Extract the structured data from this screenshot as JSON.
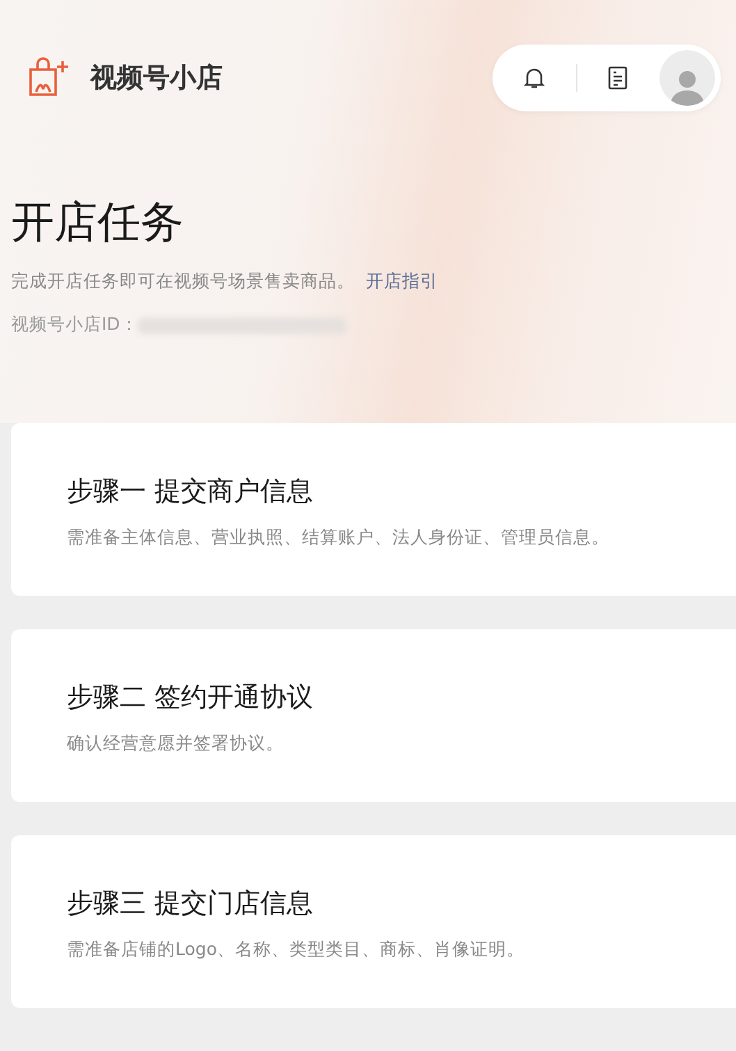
{
  "header": {
    "brand": "视频号小店"
  },
  "page": {
    "title": "开店任务",
    "description": "完成开店任务即可在视频号场景售卖商品。",
    "guide_link": "开店指引",
    "id_label": "视频号小店ID："
  },
  "steps": [
    {
      "title": "步骤一 提交商户信息",
      "description": "需准备主体信息、营业执照、结算账户、法人身份证、管理员信息。"
    },
    {
      "title": "步骤二 签约开通协议",
      "description": "确认经营意愿并签署协议。"
    },
    {
      "title": "步骤三 提交门店信息",
      "description": "需准备店铺的Logo、名称、类型类目、商标、肖像证明。"
    }
  ]
}
